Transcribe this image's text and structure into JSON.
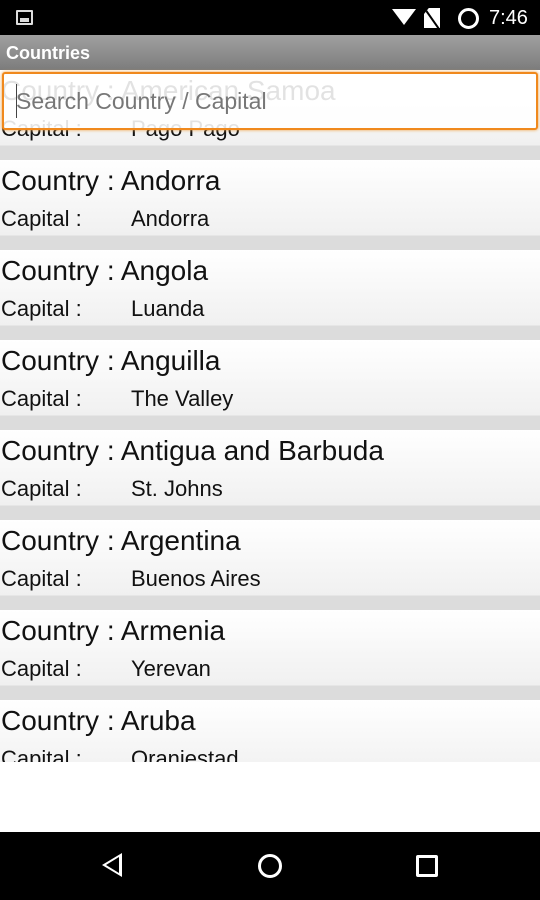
{
  "status_bar": {
    "time": "7:46",
    "icons": [
      "image-icon",
      "wifi-icon",
      "no-sim-icon",
      "sync-circle-icon"
    ]
  },
  "title_bar": {
    "title": "Countries"
  },
  "search": {
    "placeholder": "Search Country / Capital",
    "value": ""
  },
  "list": {
    "country_label": "Country : ",
    "capital_label": "Capital :",
    "items": [
      {
        "country": "American Samoa",
        "capital": "Pago Pago"
      },
      {
        "country": "Andorra",
        "capital": "Andorra"
      },
      {
        "country": "Angola",
        "capital": "Luanda"
      },
      {
        "country": "Anguilla",
        "capital": "The Valley"
      },
      {
        "country": "Antigua and Barbuda",
        "capital": "St. Johns"
      },
      {
        "country": "Argentina",
        "capital": "Buenos Aires"
      },
      {
        "country": "Armenia",
        "capital": "Yerevan"
      },
      {
        "country": "Aruba",
        "capital": "Oranjestad"
      }
    ]
  },
  "colors": {
    "accent": "#f0891d",
    "title_bar": "#8c8c8c"
  },
  "nav_bar": {
    "icons": [
      "back-icon",
      "home-icon",
      "recents-icon"
    ]
  }
}
